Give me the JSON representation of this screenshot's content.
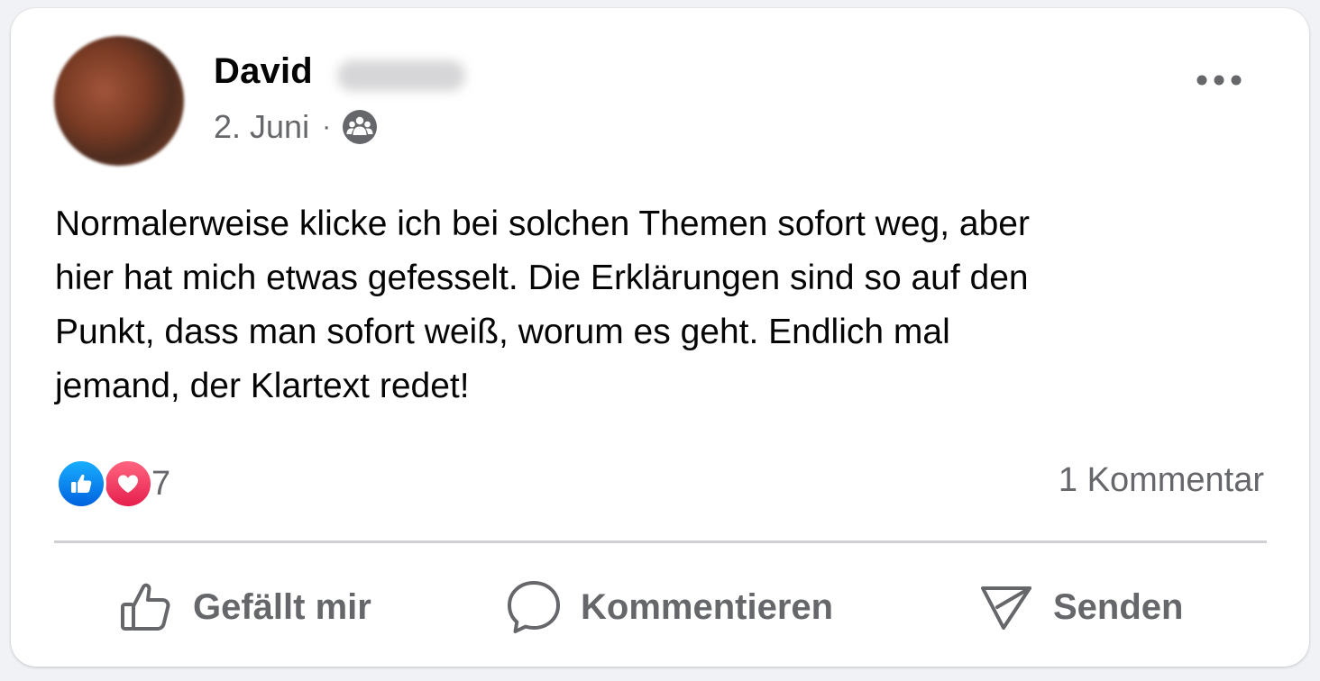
{
  "post": {
    "author": {
      "first_name": "David",
      "avatar_icon": "avatar",
      "surname_hidden": true
    },
    "date": "2. Juni",
    "separator": "·",
    "audience_icon": "group-audience-icon",
    "more_icon": "more-options-icon",
    "text": "Normalerweise klicke ich bei solchen Themen sofort weg, aber\nhier hat mich etwas gefesselt. Die Erklärungen sind so auf den\nPunkt, dass man sofort weiß, worum es geht. Endlich mal\njemand, der Klartext redet!"
  },
  "reactions": {
    "types": [
      "like",
      "love"
    ],
    "count": "7",
    "colors": {
      "like": "#0866ff",
      "love": "#f02849"
    }
  },
  "comments": {
    "count_label": "1 Kommentar"
  },
  "actions": {
    "like_label": "Gefällt mir",
    "comment_label": "Kommentieren",
    "send_label": "Senden"
  },
  "theme": {
    "text_primary": "#050505",
    "text_secondary": "#65676b",
    "divider": "#ced0d4",
    "card_bg": "#ffffff"
  }
}
